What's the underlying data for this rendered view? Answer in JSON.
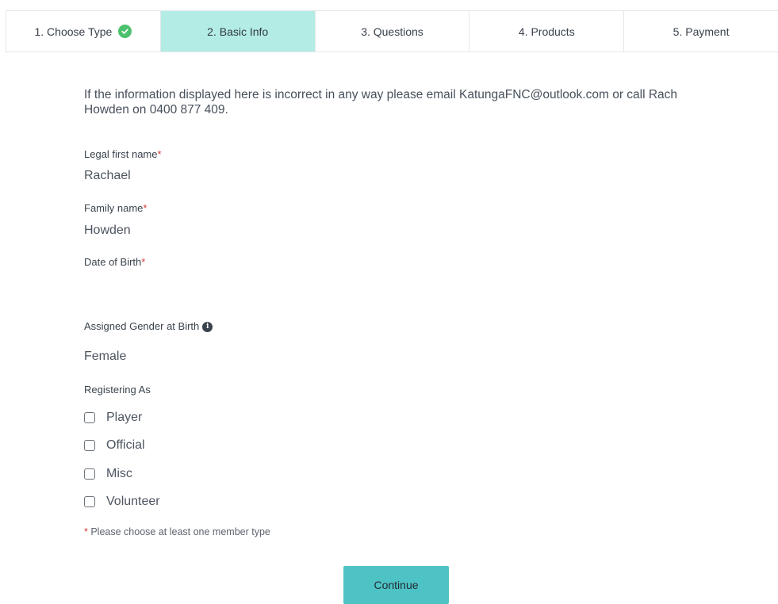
{
  "stepper": {
    "steps": [
      {
        "label": "1. Choose Type",
        "state": "complete"
      },
      {
        "label": "2. Basic Info",
        "state": "active"
      },
      {
        "label": "3. Questions",
        "state": "upcoming"
      },
      {
        "label": "4. Products",
        "state": "upcoming"
      },
      {
        "label": "5. Payment",
        "state": "upcoming"
      }
    ]
  },
  "form": {
    "intro": "If the information displayed here is incorrect in any way please email KatungaFNC@outlook.com or call Rach Howden on 0400 877 409.",
    "first_name": {
      "label": "Legal first name",
      "required_mark": "*",
      "value": "Rachael"
    },
    "family_name": {
      "label": "Family name",
      "required_mark": "*",
      "value": "Howden"
    },
    "dob": {
      "label": "Date of Birth",
      "required_mark": "*",
      "value": ""
    },
    "gender": {
      "label": "Assigned Gender at Birth",
      "info_icon": "info-icon",
      "value": "Female"
    },
    "registering_as": {
      "label": "Registering As",
      "options": [
        {
          "label": "Player",
          "checked": false
        },
        {
          "label": "Official",
          "checked": false
        },
        {
          "label": "Misc",
          "checked": false
        },
        {
          "label": "Volunteer",
          "checked": false
        }
      ],
      "hint_mark": "*",
      "hint": " Please choose at least one member type"
    },
    "continue_label": "Continue"
  },
  "colors": {
    "active_step": "#b3ece4",
    "check": "#4cc16e",
    "required": "#d23b3b",
    "button": "#4ec3c5"
  }
}
